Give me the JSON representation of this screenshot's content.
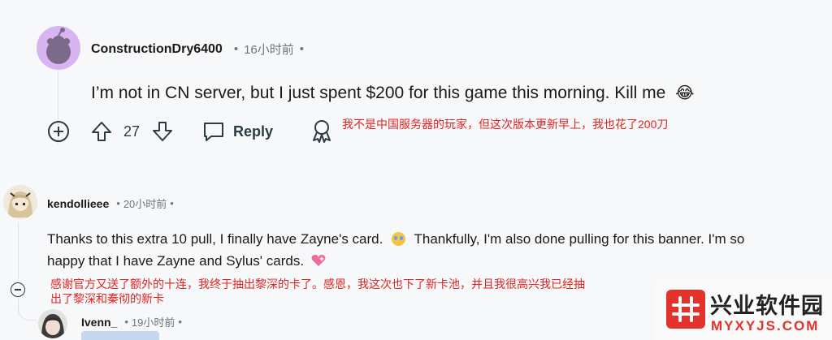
{
  "comment1": {
    "author": "ConstructionDry6400",
    "separator_a": "•",
    "time": "16小时前",
    "separator_b": "•",
    "body": "I’m not in CN server, but I just spent $200 for this game this morning. Kill me",
    "emoji": "😂",
    "upvotes": "27",
    "reply_label": "Reply",
    "translation": "我不是中国服务器的玩家，但这次版本更新早上，我也花了200刀"
  },
  "comment2": {
    "author": "kendollieee",
    "time": "20小时前",
    "separator_a": "•",
    "separator_b": "•",
    "body_line1": "Thanks to this extra 10 pull, I finally have Zayne's card.",
    "body_line1b": "Thankfully, I'm also done pulling for this banner. I'm so",
    "body_line2": "happy that I have Zayne and Sylus' cards.",
    "translation_line1": "感谢官方又送了额外的十连，我终于抽出黎深的卡了。感恩，我这次也下了新卡池，并且我很高兴我已经抽",
    "translation_line2": "出了黎深和秦彻的新卡"
  },
  "comment3": {
    "author": "Ivenn_",
    "separator_a": "•",
    "time": "19小时前",
    "separator_b": "•"
  },
  "watermark": {
    "brand": "兴业软件园",
    "url": "MYXYJS.COM"
  },
  "colors": {
    "red_note": "#e02424",
    "logo_red": "#e4312b",
    "avatar_purple": "#d9b4f2"
  }
}
